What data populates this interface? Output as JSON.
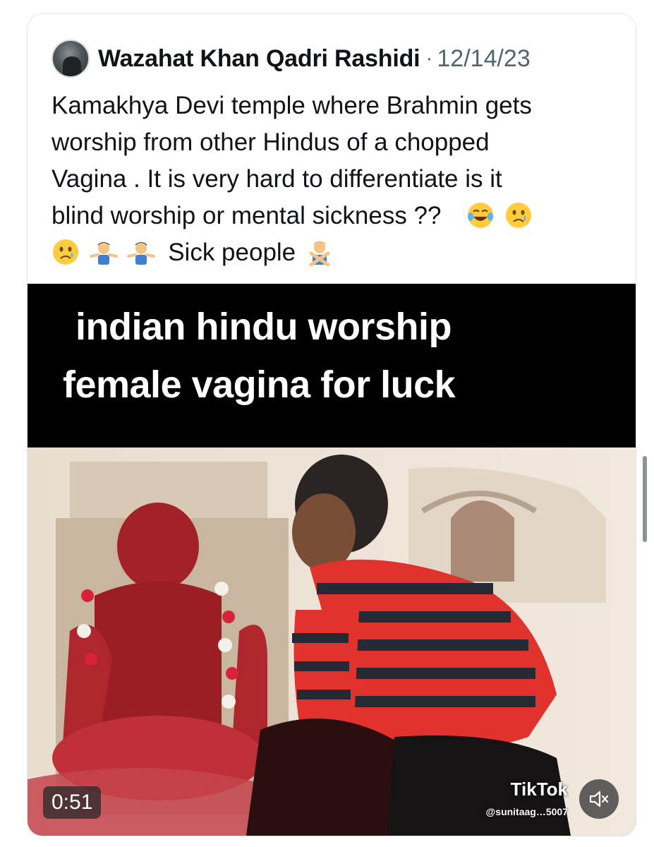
{
  "post": {
    "author_name": "Wazahat Khan Qadri Rashidi",
    "separator": "·",
    "date": "12/14/23",
    "text_lines": [
      "Kamakhya Devi temple where Brahmin gets",
      "worship from other Hindus of a chopped",
      "Vagina .  It is very hard to differentiate is it",
      "blind worship or mental sickness ??"
    ],
    "last_line_text": "Sick people",
    "emojis": [
      "face-with-tears-of-joy",
      "crying-face",
      "crying-face",
      "man-shrugging",
      "man-shrugging",
      "man-gesturing-no"
    ]
  },
  "video": {
    "caption_line_1": "indian hindu worship",
    "caption_line_2": "female vagina for luck",
    "duration": "0:51",
    "tiktok_label": "TikTok",
    "watermark": "@sunitaag…5007",
    "mute_icon": "speaker-muted-icon"
  },
  "colors": {
    "text_primary": "#0f1419",
    "text_secondary": "#536471",
    "card_border": "#e3e6e9"
  }
}
